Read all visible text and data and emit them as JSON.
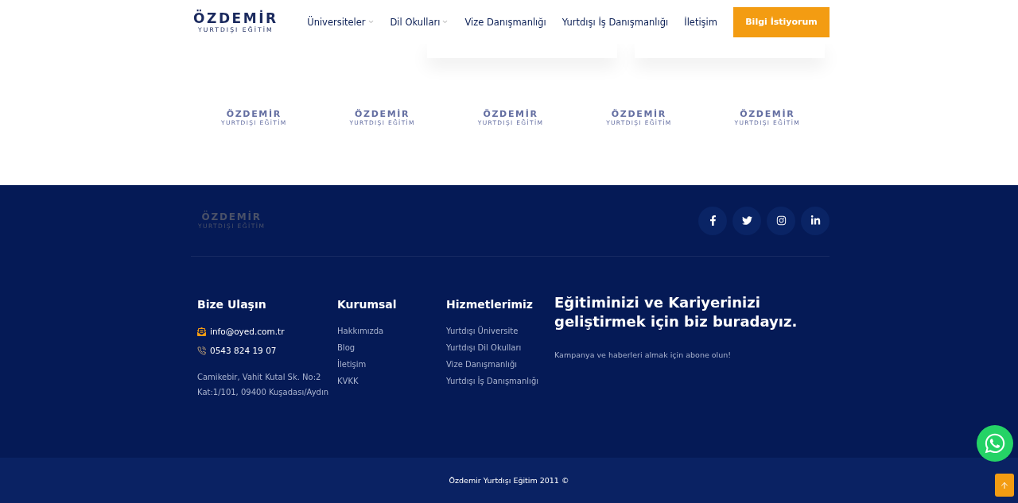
{
  "header": {
    "logo": {
      "title": "ÖZDEMİR",
      "subtitle": "YURTDIŞI EĞİTİM"
    },
    "nav": [
      {
        "label": "Üniversiteler",
        "dropdown": true
      },
      {
        "label": "Dil Okulları",
        "dropdown": true
      },
      {
        "label": "Vize Danışmanlığı",
        "dropdown": false
      },
      {
        "label": "Yurtdışı İş Danışmanlığı",
        "dropdown": false
      },
      {
        "label": "İletişim",
        "dropdown": false
      }
    ],
    "cta": "Bilgi İstiyorum"
  },
  "partner_logos": [
    {
      "title": "ÖZDEMİR",
      "subtitle": "YURTDIŞI EĞİTİM"
    },
    {
      "title": "ÖZDEMİR",
      "subtitle": "YURTDIŞI EĞİTİM"
    },
    {
      "title": "ÖZDEMİR",
      "subtitle": "YURTDIŞI EĞİTİM"
    },
    {
      "title": "ÖZDEMİR",
      "subtitle": "YURTDIŞI EĞİTİM"
    },
    {
      "title": "ÖZDEMİR",
      "subtitle": "YURTDIŞI EĞİTİM"
    }
  ],
  "footer": {
    "logo": {
      "title": "ÖZDEMİR",
      "subtitle": "YURTDIŞI EĞİTİM"
    },
    "social": [
      {
        "kind": "facebook"
      },
      {
        "kind": "twitter"
      },
      {
        "kind": "instagram"
      },
      {
        "kind": "linkedin"
      }
    ],
    "contact": {
      "heading": "Bize Ulaşın",
      "email": "info@oyed.com.tr",
      "phone": "0543 824 19 07",
      "address": [
        "Camikebir, Vahit Kutal Sk. No:2",
        "Kat:1/101, 09400 Kuşadası/Aydın"
      ]
    },
    "columns": [
      {
        "heading": "Kurumsal",
        "links": [
          "Hakkımızda",
          "Blog",
          "İletişim",
          "KVKK"
        ]
      },
      {
        "heading": "Hizmetlerimiz",
        "links": [
          "Yurtdışı Üniversite",
          "Yurtdışı Dil Okulları",
          "Vize Danışmanlığı",
          "Yurtdışı İş Danışmanlığı"
        ]
      }
    ],
    "newsletter": {
      "heading": "Eğitiminizi ve Kariyerinizi geliştirmek için biz buradayız.",
      "text": "Kampanya ve haberleri almak için abone olun!"
    },
    "copyright": "Özdemir Yurtdışı Eğitim 2011 ©"
  }
}
